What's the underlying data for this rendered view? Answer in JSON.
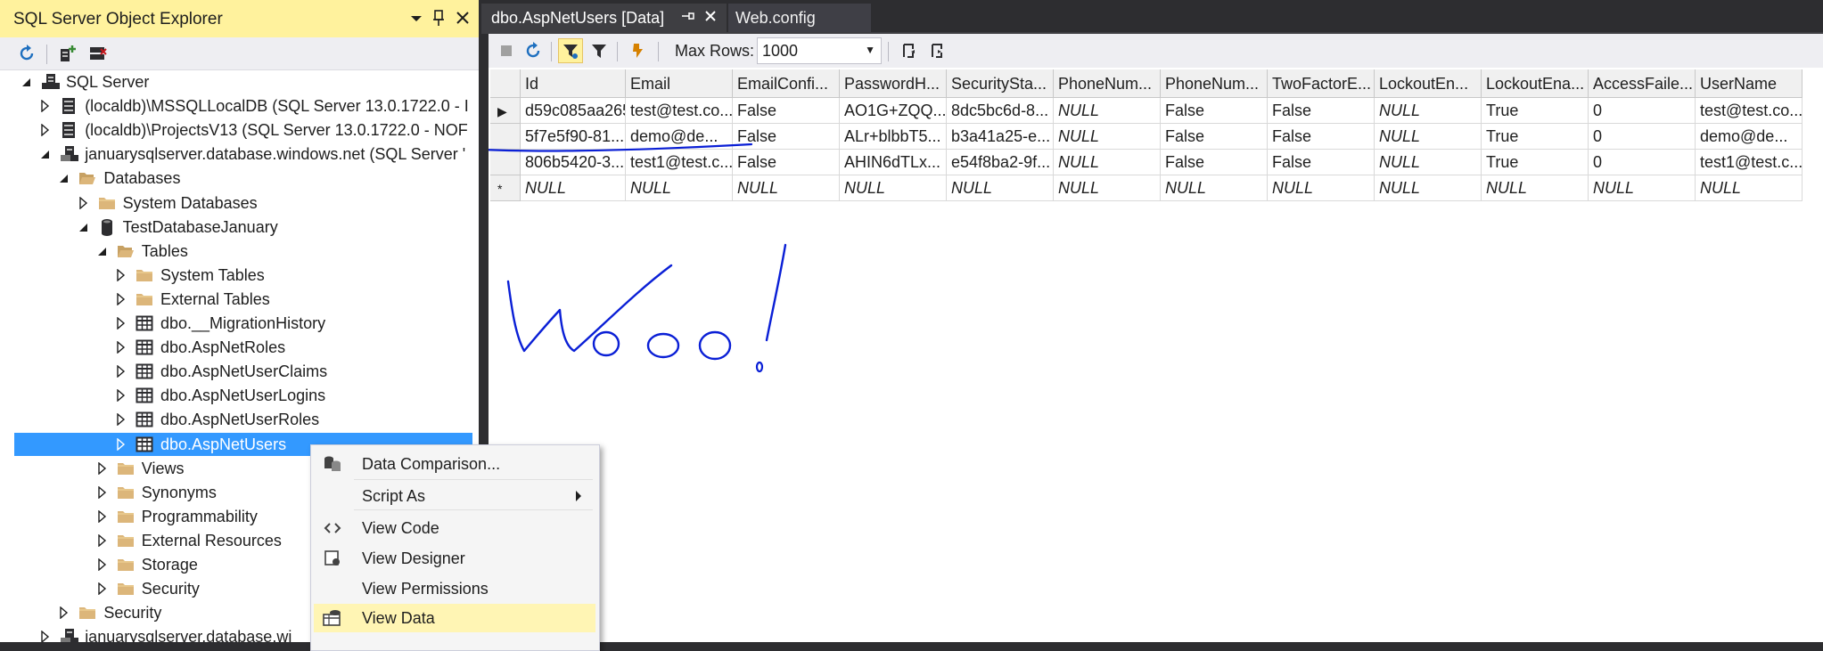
{
  "explorer": {
    "title": "SQL Server Object Explorer",
    "tree": [
      {
        "label": "SQL Server",
        "depth": 0,
        "expanded": true,
        "icon": "server-root-icon"
      },
      {
        "label": "(localdb)\\MSSQLLocalDB (SQL Server 13.0.1722.0 - I",
        "depth": 1,
        "expanded": false,
        "icon": "server-icon"
      },
      {
        "label": "(localdb)\\ProjectsV13 (SQL Server 13.0.1722.0 - NOF",
        "depth": 1,
        "expanded": false,
        "icon": "server-icon"
      },
      {
        "label": "januarysqlserver.database.windows.net (SQL Server '",
        "depth": 1,
        "expanded": true,
        "icon": "azure-server-icon"
      },
      {
        "label": "Databases",
        "depth": 2,
        "expanded": true,
        "icon": "folder-open-icon"
      },
      {
        "label": "System Databases",
        "depth": 3,
        "expanded": false,
        "icon": "folder-icon"
      },
      {
        "label": "TestDatabaseJanuary",
        "depth": 3,
        "expanded": true,
        "icon": "database-icon"
      },
      {
        "label": "Tables",
        "depth": 4,
        "expanded": true,
        "icon": "folder-open-icon"
      },
      {
        "label": "System Tables",
        "depth": 5,
        "expanded": false,
        "icon": "folder-icon"
      },
      {
        "label": "External Tables",
        "depth": 5,
        "expanded": false,
        "icon": "folder-icon"
      },
      {
        "label": "dbo.__MigrationHistory",
        "depth": 5,
        "expanded": false,
        "icon": "table-icon"
      },
      {
        "label": "dbo.AspNetRoles",
        "depth": 5,
        "expanded": false,
        "icon": "table-icon"
      },
      {
        "label": "dbo.AspNetUserClaims",
        "depth": 5,
        "expanded": false,
        "icon": "table-icon"
      },
      {
        "label": "dbo.AspNetUserLogins",
        "depth": 5,
        "expanded": false,
        "icon": "table-icon"
      },
      {
        "label": "dbo.AspNetUserRoles",
        "depth": 5,
        "expanded": false,
        "icon": "table-icon"
      },
      {
        "label": "dbo.AspNetUsers",
        "depth": 5,
        "expanded": false,
        "icon": "table-icon",
        "selected": true
      },
      {
        "label": "Views",
        "depth": 4,
        "expanded": false,
        "icon": "folder-icon"
      },
      {
        "label": "Synonyms",
        "depth": 4,
        "expanded": false,
        "icon": "folder-icon"
      },
      {
        "label": "Programmability",
        "depth": 4,
        "expanded": false,
        "icon": "folder-icon"
      },
      {
        "label": "External Resources",
        "depth": 4,
        "expanded": false,
        "icon": "folder-icon"
      },
      {
        "label": "Storage",
        "depth": 4,
        "expanded": false,
        "icon": "folder-icon"
      },
      {
        "label": "Security",
        "depth": 4,
        "expanded": false,
        "icon": "folder-icon"
      },
      {
        "label": "Security",
        "depth": 2,
        "expanded": false,
        "icon": "folder-icon"
      },
      {
        "label": "januarysqlserver.database.wi",
        "depth": 1,
        "expanded": false,
        "icon": "azure-server-icon"
      }
    ]
  },
  "tabs": [
    {
      "label": "dbo.AspNetUsers [Data]",
      "active": true
    },
    {
      "label": "Web.config",
      "active": false
    }
  ],
  "toolbar": {
    "max_rows_label": "Max Rows:",
    "max_rows_value": "1000"
  },
  "grid": {
    "columns": [
      "Id",
      "Email",
      "EmailConfi...",
      "PasswordH...",
      "SecuritySta...",
      "PhoneNum...",
      "PhoneNum...",
      "TwoFactorE...",
      "LockoutEn...",
      "LockoutEna...",
      "AccessFaile...",
      "UserName"
    ],
    "rows": [
      {
        "marker": "▶",
        "cells": [
          "d59c085aa265",
          "test@test.co...",
          "False",
          "AO1G+ZQQ...",
          "8dc5bc6d-8...",
          "NULL",
          "False",
          "False",
          "NULL",
          "True",
          "0",
          "test@test.co..."
        ]
      },
      {
        "marker": "",
        "cells": [
          "5f7e5f90-81...",
          "demo@de...",
          "False",
          "ALr+blbbT5...",
          "b3a41a25-e...",
          "NULL",
          "False",
          "False",
          "NULL",
          "True",
          "0",
          "demo@de..."
        ]
      },
      {
        "marker": "",
        "cells": [
          "806b5420-3...",
          "test1@test.c...",
          "False",
          "AHIN6dTLx...",
          "e54f8ba2-9f...",
          "NULL",
          "False",
          "False",
          "NULL",
          "True",
          "0",
          "test1@test.c..."
        ]
      },
      {
        "marker": "*",
        "cells": [
          "NULL",
          "NULL",
          "NULL",
          "NULL",
          "NULL",
          "NULL",
          "NULL",
          "NULL",
          "NULL",
          "NULL",
          "NULL",
          "NULL"
        ]
      }
    ]
  },
  "context_menu": {
    "items": [
      {
        "label": "Data Comparison...",
        "icon": "data-compare-icon",
        "submenu": false
      },
      {
        "label": "Script As",
        "icon": "",
        "submenu": true
      },
      {
        "label": "View Code",
        "icon": "code-icon",
        "submenu": false
      },
      {
        "label": "View Designer",
        "icon": "designer-icon",
        "submenu": false
      },
      {
        "label": "View Permissions",
        "icon": "",
        "submenu": false
      },
      {
        "label": "View Data",
        "icon": "view-data-icon",
        "submenu": false,
        "highlighted": true
      }
    ]
  },
  "colors": {
    "title_highlight": "#fff29d",
    "selection": "#3399ff",
    "menu_highlight": "#fff5b4",
    "ink": "#0a1fd6",
    "folder": "#dcb67a"
  }
}
